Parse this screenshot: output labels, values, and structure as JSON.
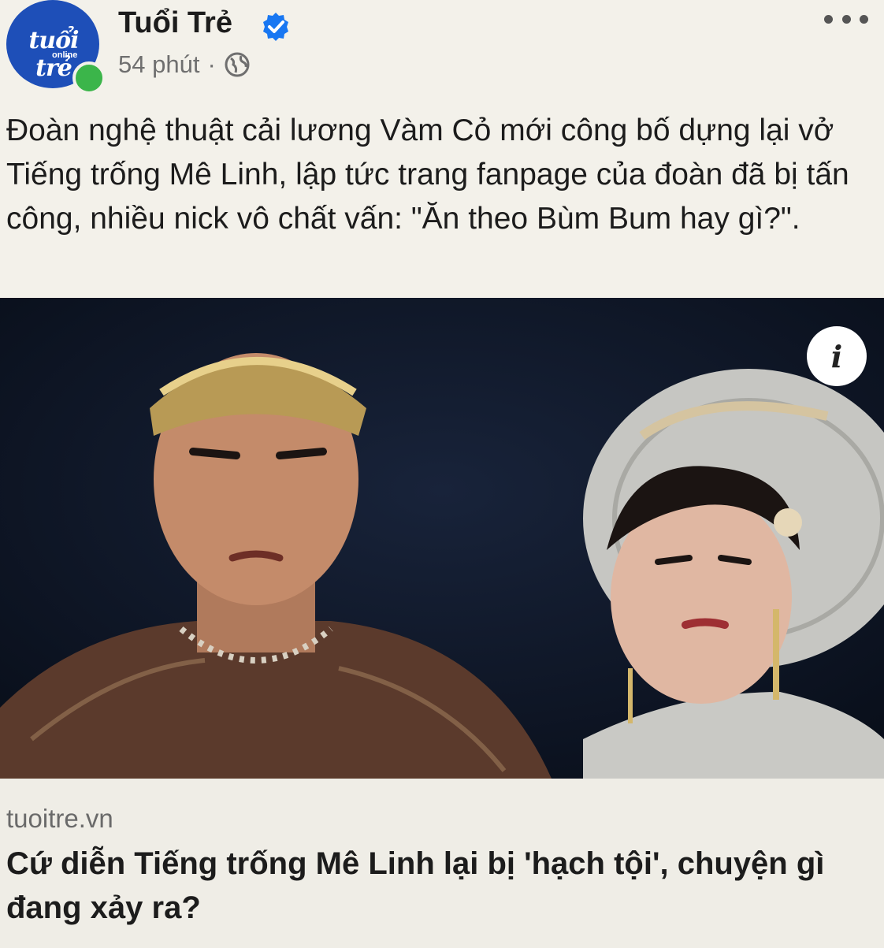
{
  "post": {
    "page_name": "Tuổi Trẻ",
    "time": "54 phút",
    "separator": "·",
    "avatar_logo": "tuổi trẻ",
    "avatar_sub": "online",
    "text": "Đoàn nghệ thuật cải lương Vàm Cỏ mới công bố dựng lại vở Tiếng trống Mê Linh, lập tức trang fanpage của đoàn đã bị tấn công, nhiều nick vô chất vấn: \"Ăn theo Bùm Bum hay gì?\".",
    "icons": {
      "verified": "verified-badge-icon",
      "audience": "globe-icon",
      "more": "more-options-icon",
      "info": "info-icon"
    }
  },
  "link": {
    "domain": "tuoitre.vn",
    "title": "Cứ diễn Tiếng trống Mê Linh lại bị 'hạch tội', chuyện gì đang xảy ra?"
  },
  "colors": {
    "background": "#f3f1ea",
    "avatar": "#1e4fb8",
    "online": "#3bb54a",
    "verified": "#1877f2",
    "photo_bg": "#0b1322"
  }
}
